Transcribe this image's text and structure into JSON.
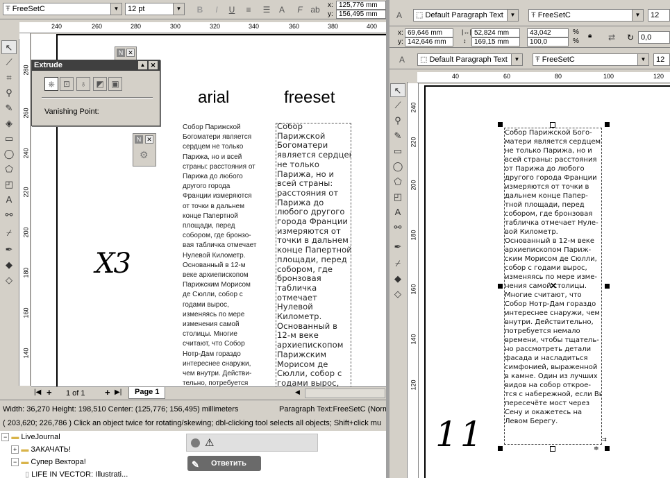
{
  "left": {
    "font_name": "FreeSetC",
    "font_size": "12 pt",
    "coord_x": "125,776 mm",
    "coord_y": "156,495 mm",
    "ruler_h": [
      "240",
      "260",
      "280",
      "300",
      "320",
      "340",
      "360",
      "380",
      "400",
      "420"
    ],
    "ruler_v": [
      "280",
      "260",
      "240",
      "220",
      "200",
      "180",
      "160",
      "140"
    ],
    "ruler_unit": "millimeters",
    "extrude": {
      "title": "Extrude",
      "label": "Vanishing Point:"
    },
    "heading_arial": "arial",
    "heading_freeset": "freeset",
    "handwritten": "X3",
    "arial_lines": [
      "Собор Парижской",
      "Богоматери является",
      "сердцем не только",
      "Парижа, но и всей",
      "страны: расстояния от",
      "Парижа до любого",
      "другого города",
      "Франции измеряются",
      "от точки в дальнем",
      "конце Папертной",
      "площади, перед",
      "собором, где бронзо-",
      "вая табличка отмечает",
      "Нулевой Километр.",
      "Основанный в 12-м",
      "веке архиепископом",
      "Парижским Морисом",
      "де Сюлли, собор с",
      "годами вырос,",
      "изменяясь по мере",
      "изменения самой",
      "столицы. Многие",
      "считают, что Собор",
      "Нотр-Дам гораздо",
      "интереснее снаружи,",
      "чем внутри. Действи-",
      "тельно, потребуется"
    ],
    "freeset_lines": [
      "Собор",
      "Парижской",
      "Богоматери",
      "является сердцем",
      "не только",
      "Парижа, но и",
      "всей страны:",
      "расстояния от",
      "Парижа до",
      "любого другого",
      "города Франции",
      "измеряются от",
      "точки в дальнем",
      "конце Папертной",
      "площади, перед",
      "собором, где",
      "бронзовая",
      "табличка",
      "отмечает",
      "Нулевой",
      "Километр.",
      "Основанный в",
      "12-м веке",
      "архиепископом",
      "Парижским",
      "Морисом де",
      "Сюлли, собор с",
      "годами вырос,"
    ],
    "page_nav": "1 of 1",
    "page_tab": "Page 1",
    "status1_left": "Width: 36,270  Height: 198,510  Center: (125,776; 156,495)  millimeters",
    "status1_right": "Paragraph Text:FreeSetC (Norm",
    "status2": "( 203,620; 226,786 )     Click an object twice for rotating/skewing; dbl-clicking tool selects all objects; Shift+click mu",
    "tree": [
      "LiveJournal",
      "ЗАКАЧАТЬ!",
      "Супер Вектора!",
      "LIFE IN VECTOR: Illustrati..."
    ],
    "reply_button": "Ответить"
  },
  "right": {
    "style1": "Default Paragraph Text",
    "font1": "FreeSetC",
    "size1": "12",
    "x": "69,646 mm",
    "y": "142,646 mm",
    "w": "52,824 mm",
    "h": "169,15 mm",
    "sx": "43,042",
    "sy": "100,0",
    "pct": "%",
    "rot": "0,0",
    "style2": "Default Paragraph Text",
    "font2": "FreeSetC",
    "size2": "12",
    "ruler_h": [
      "40",
      "60",
      "80",
      "100",
      "120"
    ],
    "ruler_v": [
      "240",
      "220",
      "200",
      "180",
      "160",
      "140",
      "120"
    ],
    "handwritten": "11",
    "text_lines": [
      "Собор Парижской Бого-",
      "матери является сердцем",
      "не только Парижа, но и",
      "всей страны: расстояния",
      "от Парижа до любого",
      "другого города Франции",
      "измеряются от точки в",
      "дальнем конце Папер-",
      "тной площади, перед",
      "собором, где бронзовая",
      "табличка отмечает Нуле-",
      "вой Километр.",
      "Основанный в 12-м веке",
      "архиепископом Париж-",
      "ским Морисом де Сюлли,",
      "собор с годами вырос,",
      "изменяясь по мере изме-",
      "нения самой столицы.",
      "Многие считают, что",
      "Собор Нотр-Дам гораздо",
      "интереснее снаружи, чем",
      "внутри. Действительно,",
      "потребуется немало",
      "времени, чтобы тщатель-",
      "но рассмотреть детали",
      "фасада и насладиться",
      "симфонией, выраженной",
      "в камне. Один из лучших",
      "видов на собор открое-",
      "тся с набережной, если Вы",
      "пересечёте мост через",
      "Сену и окажетесь на",
      "Левом Берегу."
    ]
  }
}
